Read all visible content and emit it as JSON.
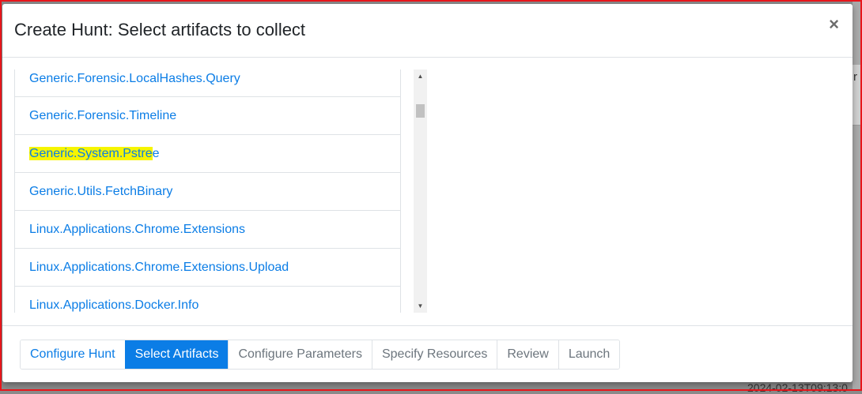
{
  "background": {
    "clipped_right_text": "r",
    "clipped_bottom_text": "2024-02-13T09:13:0"
  },
  "modal": {
    "title": "Create Hunt: Select artifacts to collect",
    "close_label": "×"
  },
  "artifacts": [
    {
      "label": "Generic.Forensic.LocalHashes.Query"
    },
    {
      "label": "Generic.Forensic.Timeline"
    },
    {
      "label": "Generic.System.Pstree",
      "highlight": "Generic.System.Pstre",
      "rest": "e"
    },
    {
      "label": "Generic.Utils.FetchBinary"
    },
    {
      "label": "Linux.Applications.Chrome.Extensions"
    },
    {
      "label": "Linux.Applications.Chrome.Extensions.Upload"
    },
    {
      "label": "Linux.Applications.Docker.Info"
    }
  ],
  "scrollbar": {
    "up_icon": "▲",
    "down_icon": "▼"
  },
  "steps": {
    "configure_hunt": "Configure Hunt",
    "select_artifacts": "Select Artifacts",
    "configure_parameters": "Configure Parameters",
    "specify_resources": "Specify Resources",
    "review": "Review",
    "launch": "Launch"
  },
  "colors": {
    "accent": "#0b7de6",
    "highlight": "#f6f500",
    "frame": "#e8151b"
  }
}
